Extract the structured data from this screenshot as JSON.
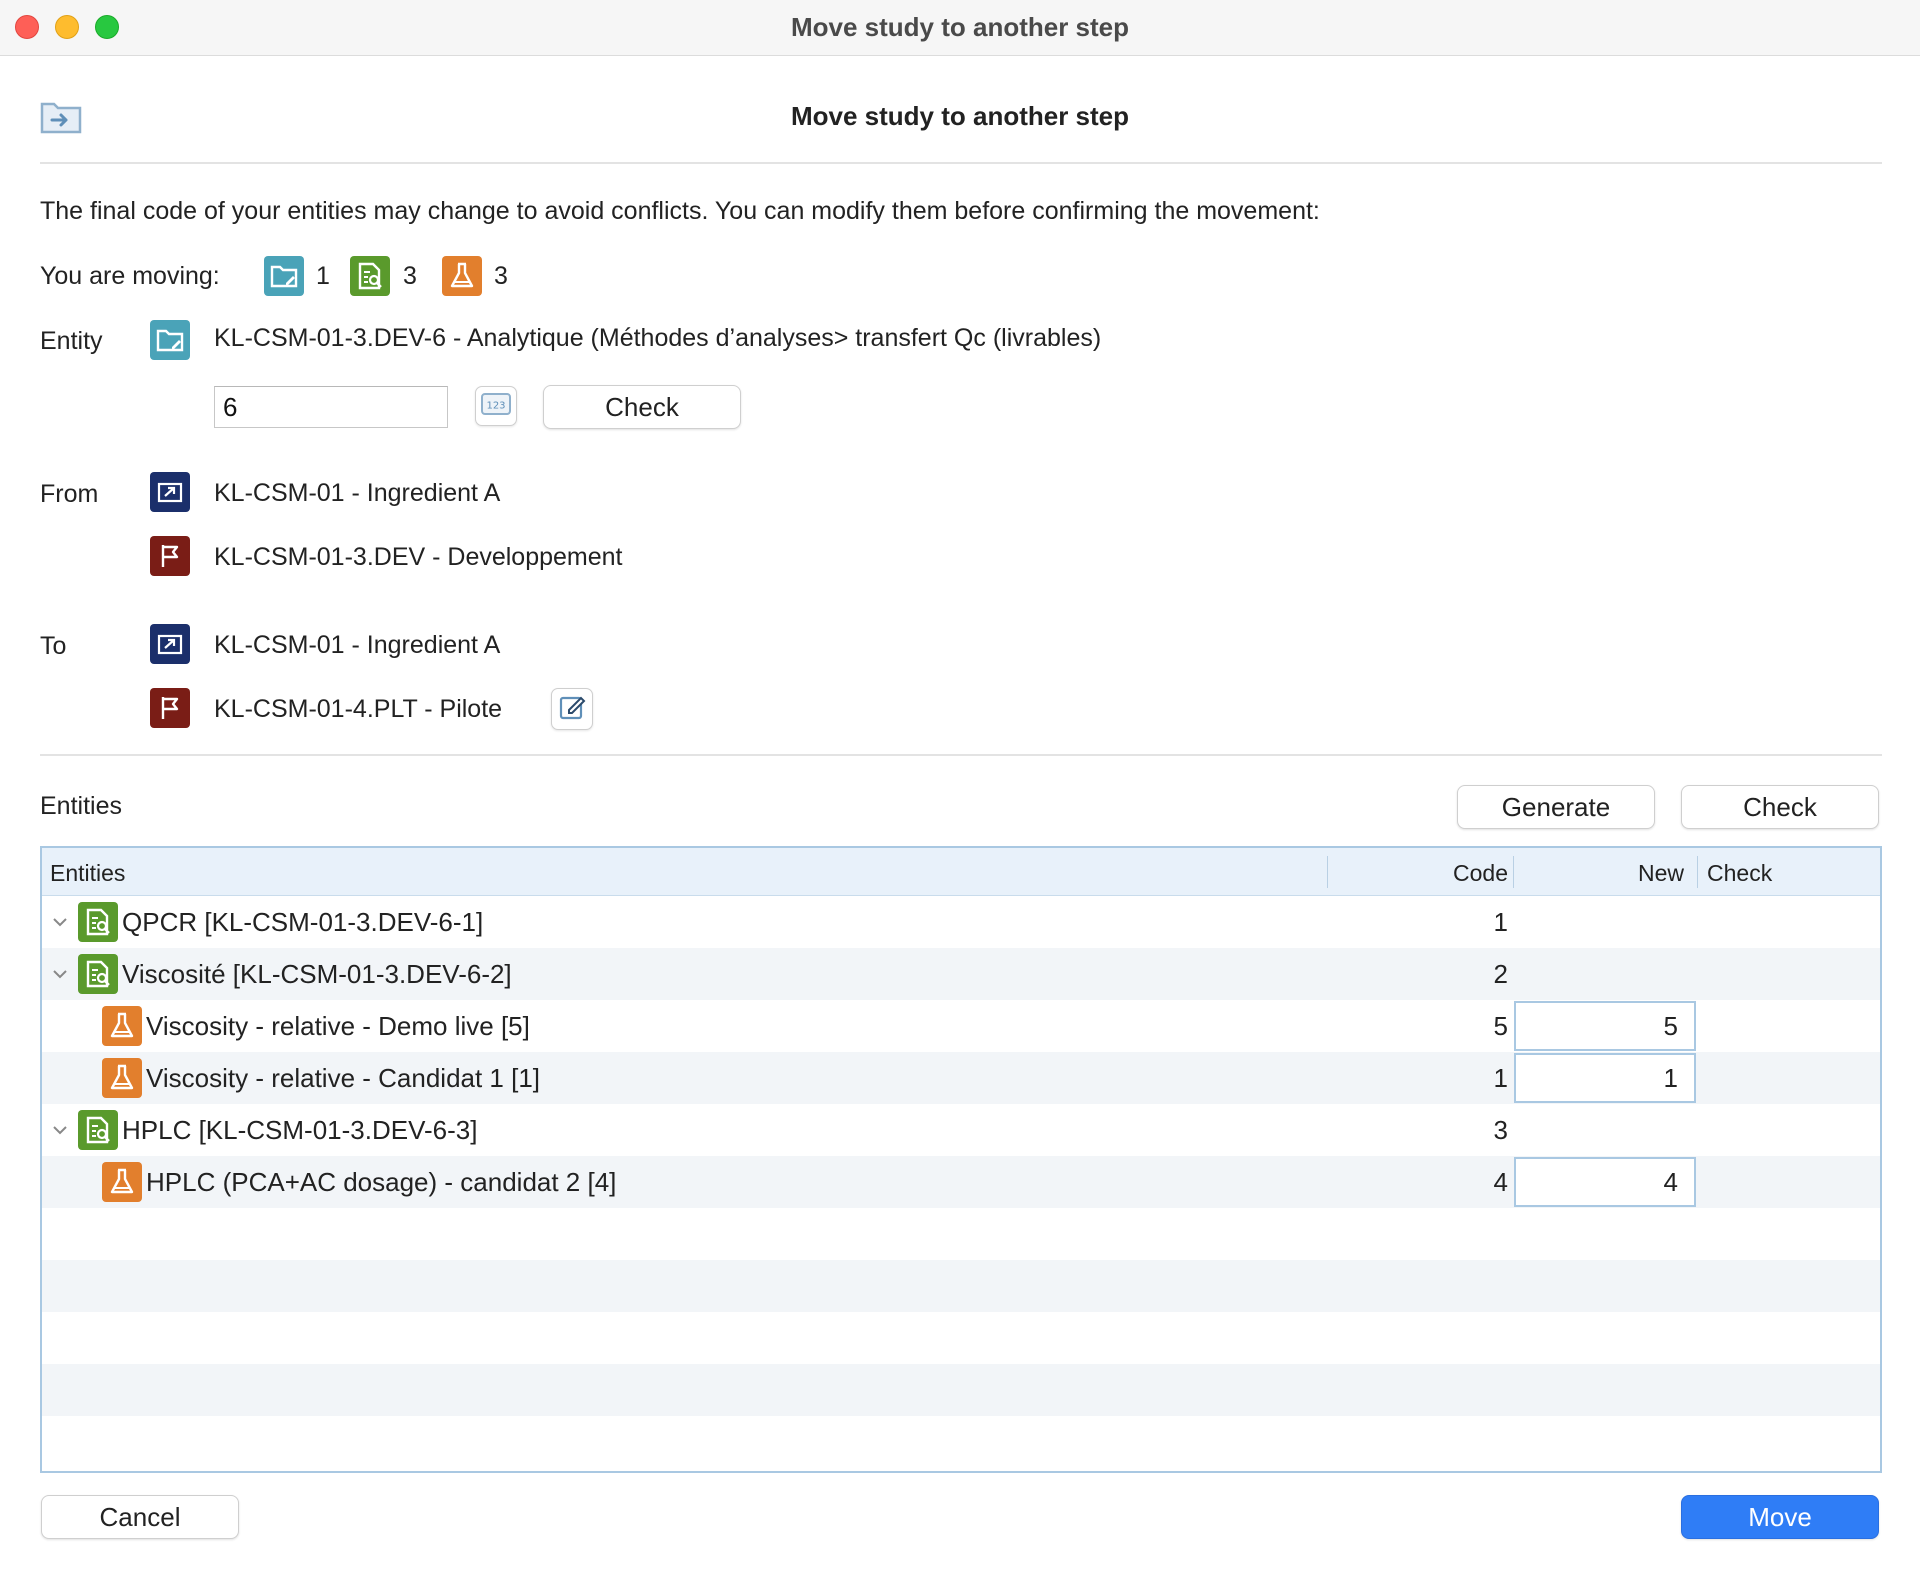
{
  "window": {
    "title": "Move study to another step"
  },
  "header": {
    "title": "Move study to another step",
    "icon": "folder-move-icon"
  },
  "info_text": "The final code of your entities may change to avoid conflicts. You can modify them before confirming the movement:",
  "moving": {
    "label": "You are moving:",
    "items": [
      {
        "icon": "folder-edit-icon",
        "count": "1",
        "color": "#4aa3b8"
      },
      {
        "icon": "analysis-icon",
        "count": "3",
        "color": "#5a9a2c"
      },
      {
        "icon": "flask-icon",
        "count": "3",
        "color": "#e27f2d"
      }
    ]
  },
  "entity": {
    "label": "Entity",
    "name": "KL-CSM-01-3.DEV-6 - Analytique (Méthodes d’analyses> transfert Qc (livrables)",
    "code_value": "6",
    "check_label": "Check"
  },
  "from": {
    "label": "From",
    "project": "KL-CSM-01 - Ingredient A",
    "step": "KL-CSM-01-3.DEV - Developpement"
  },
  "to": {
    "label": "To",
    "project": "KL-CSM-01 - Ingredient A",
    "step": "KL-CSM-01-4.PLT - Pilote"
  },
  "entities_section": {
    "label": "Entities",
    "generate_label": "Generate",
    "check_label": "Check"
  },
  "table": {
    "columns": {
      "entities": "Entities",
      "code": "Code",
      "new": "New",
      "check": "Check"
    },
    "rows": [
      {
        "level": 0,
        "type": "analysis",
        "label": "QPCR [KL-CSM-01-3.DEV-6-1]",
        "code": "1",
        "new": ""
      },
      {
        "level": 0,
        "type": "analysis",
        "label": "Viscosité [KL-CSM-01-3.DEV-6-2]",
        "code": "2",
        "new": ""
      },
      {
        "level": 1,
        "type": "flask",
        "label": "Viscosity - relative - Demo live [5]",
        "code": "5",
        "new": "5"
      },
      {
        "level": 1,
        "type": "flask",
        "label": "Viscosity - relative - Candidat 1 [1]",
        "code": "1",
        "new": "1"
      },
      {
        "level": 0,
        "type": "analysis",
        "label": "HPLC [KL-CSM-01-3.DEV-6-3]",
        "code": "3",
        "new": ""
      },
      {
        "level": 1,
        "type": "flask",
        "label": "HPLC (PCA+AC dosage) - candidat 2 [4]",
        "code": "4",
        "new": "4"
      }
    ]
  },
  "footer": {
    "cancel_label": "Cancel",
    "move_label": "Move"
  },
  "colors": {
    "accent": "#2f7df6",
    "teal": "#4aa3b8",
    "green": "#5a9a2c",
    "orange": "#e27f2d",
    "navy": "#1b2f6b",
    "maroon": "#7a1d16"
  }
}
